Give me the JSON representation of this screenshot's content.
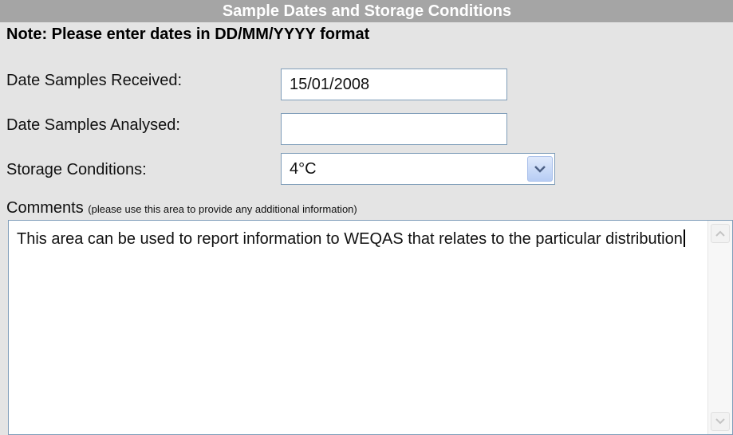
{
  "section": {
    "title": "Sample Dates and Storage Conditions",
    "note": "Note: Please enter dates in DD/MM/YYYY format"
  },
  "fields": {
    "received_label": "Date Samples Received:",
    "received_value": "15/01/2008",
    "analysed_label": "Date Samples Analysed:",
    "analysed_value": "",
    "storage_label": "Storage Conditions:",
    "storage_value": "4°C"
  },
  "comments": {
    "label": "Comments",
    "hint": "(please use this area to provide any additional information)",
    "text": "This area can be used to report information to WEQAS that relates to the particular distribution"
  },
  "icons": {
    "select_arrow": "chevron-down-icon",
    "scroll_up": "scroll-up-icon",
    "scroll_down": "scroll-down-icon"
  },
  "colors": {
    "header_bg": "#a5a5a5",
    "panel_bg": "#e4e4e4",
    "input_border": "#7f9db9"
  }
}
